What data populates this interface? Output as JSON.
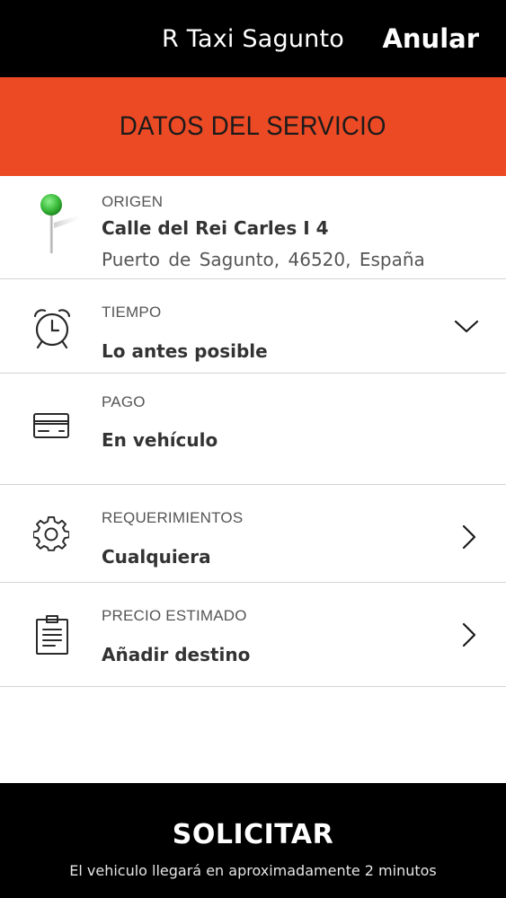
{
  "header": {
    "title": "R Taxi Sagunto",
    "cancel_label": "Anular"
  },
  "banner": {
    "title": "DATOS DEL SERVICIO"
  },
  "origin": {
    "label": "ORIGEN",
    "street": "Calle del Rei Carles I 4",
    "locality": "Puerto de Sagunto,  46520,  España",
    "icon": "map-pin-icon",
    "pin_color": "#3fbf3f"
  },
  "time": {
    "label": "TIEMPO",
    "value": "Lo antes posible",
    "icon": "alarm-clock-icon"
  },
  "payment": {
    "label": "PAGO",
    "value": "En vehículo",
    "icon": "credit-card-icon"
  },
  "requirements": {
    "label": "REQUERIMIENTOS",
    "value": "Cualquiera",
    "icon": "gear-icon"
  },
  "price": {
    "label": "PRECIO ESTIMADO",
    "value": "Añadir destino",
    "icon": "clipboard-icon"
  },
  "footer": {
    "submit_label": "SOLICITAR",
    "eta_text": "El vehiculo llegará en aproximadamente 2 minutos"
  },
  "colors": {
    "accent": "#ec4a24",
    "bar": "#000000"
  }
}
